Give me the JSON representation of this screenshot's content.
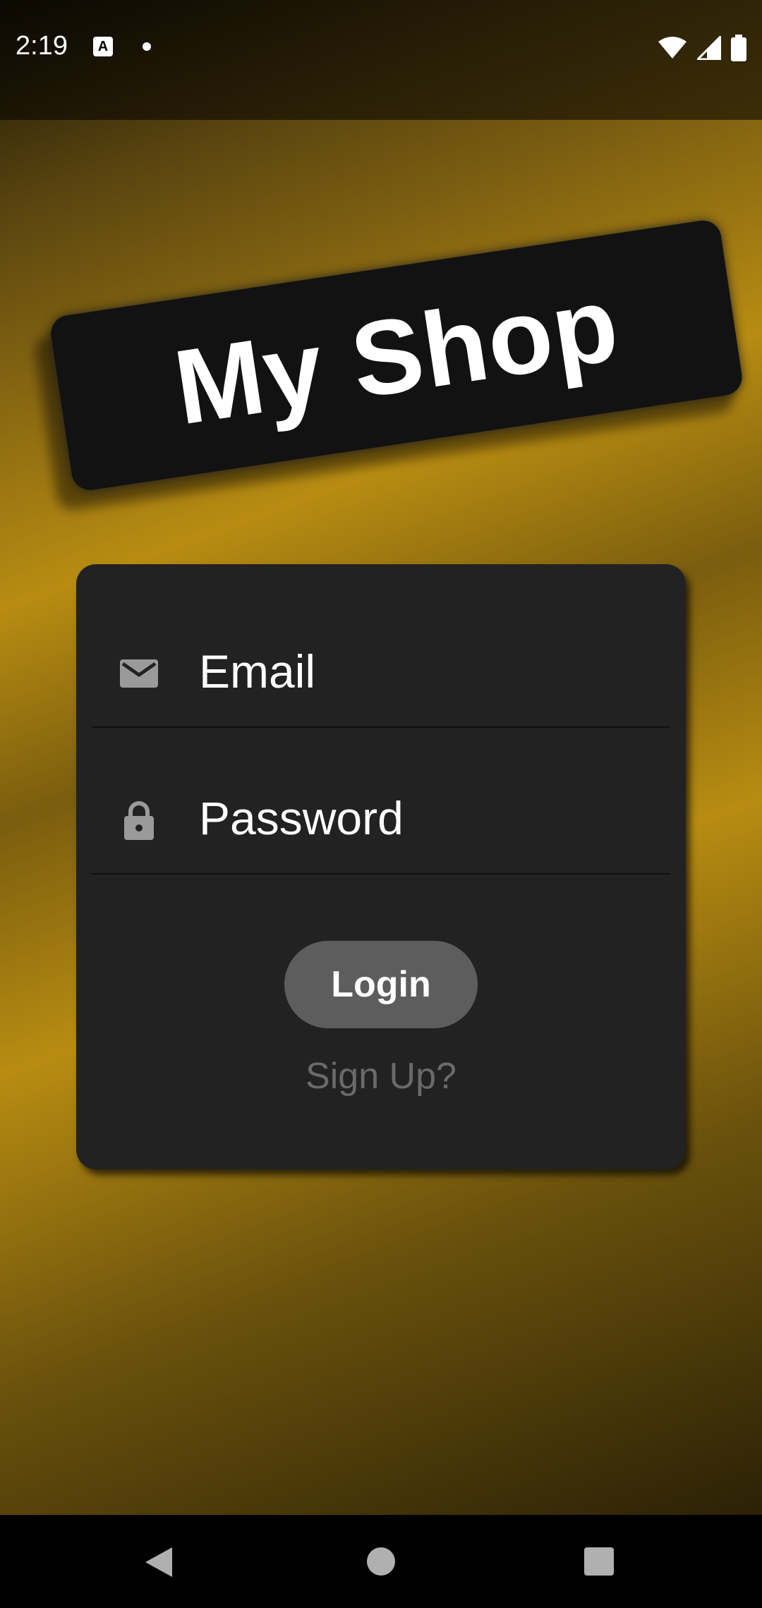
{
  "status_bar": {
    "time": "2:19",
    "notification_icon_letter": "A",
    "icons": [
      "a-notification-icon",
      "dot-icon",
      "wifi-icon",
      "signal-icon",
      "battery-icon"
    ]
  },
  "logo": {
    "text": "My Shop"
  },
  "login_form": {
    "email_placeholder": "Email",
    "password_placeholder": "Password",
    "login_label": "Login",
    "signup_label": "Sign Up?"
  },
  "nav_bar": {
    "icons": [
      "back-icon",
      "home-icon",
      "recents-icon"
    ]
  },
  "colors": {
    "gold": "#b88c12",
    "card": "#222222",
    "button": "#5d5d5d",
    "signup_text": "#6a6a6a"
  }
}
